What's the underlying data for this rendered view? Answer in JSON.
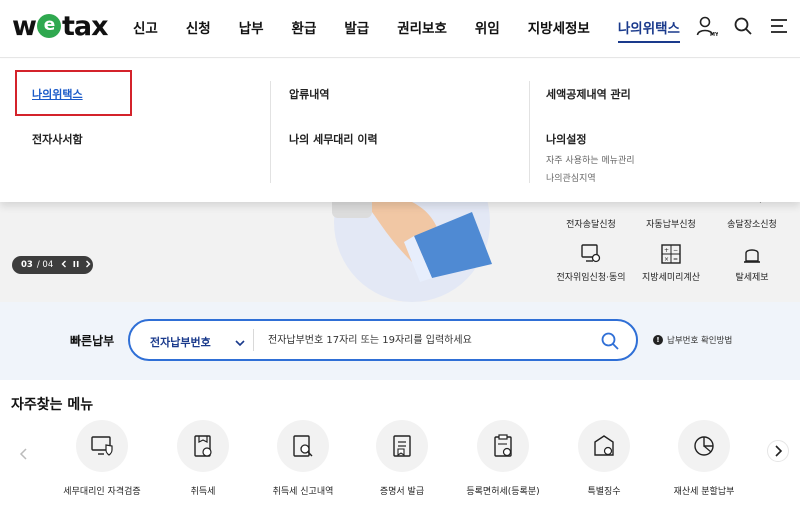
{
  "header": {
    "logo": {
      "pre": "w",
      "mid": "e",
      "post": "tax"
    },
    "nav": [
      "신고",
      "신청",
      "납부",
      "환급",
      "발급",
      "권리보호",
      "위임",
      "지방세정보",
      "나의위택스"
    ],
    "icons": [
      "user-my-icon",
      "search-icon",
      "menu-icon"
    ],
    "my_badge": "MY"
  },
  "mega_menu": {
    "col1": [
      "나의위택스",
      "전자사서함"
    ],
    "col2": [
      "압류내역",
      "나의 세무대리 이력"
    ],
    "col3": {
      "item1": "세액공제내역 관리",
      "item2": "나의설정",
      "subs": [
        "자주 사용하는 메뉴관리",
        "나의관심지역"
      ]
    }
  },
  "hero": {
    "pager": {
      "current": "03",
      "total": "/ 04"
    },
    "quick_icons": [
      {
        "label": "전자송달신청",
        "icon": "mail-icon"
      },
      {
        "label": "자동납부신청",
        "icon": "auto-pay-icon"
      },
      {
        "label": "송달장소신청",
        "icon": "location-icon"
      },
      {
        "label": "전자위임신청·동의",
        "icon": "delegate-icon"
      },
      {
        "label": "지방세미리계산",
        "icon": "calculator-icon"
      },
      {
        "label": "탈세제보",
        "icon": "siren-icon"
      }
    ]
  },
  "quick_pay": {
    "title": "빠른납부",
    "select": "전자납부번호",
    "placeholder": "전자납부번호 17자리 또는 19자리를 입력하세요",
    "help": "납부번호 확인방법",
    "help_mark": "!"
  },
  "favorites": {
    "title": "자주찾는 메뉴",
    "items": [
      {
        "label": "세무대리인 자격검증",
        "icon": "monitor-shield-icon"
      },
      {
        "label": "취득세",
        "icon": "tax-doc-icon"
      },
      {
        "label": "취득세 신고내역",
        "icon": "doc-search-icon"
      },
      {
        "label": "증명서 발급",
        "icon": "certificate-icon"
      },
      {
        "label": "등록면허세(등록분)",
        "icon": "clipboard-icon"
      },
      {
        "label": "특별징수",
        "icon": "mailbox-icon"
      },
      {
        "label": "재산세 분할납부",
        "icon": "pie-chart-icon"
      }
    ]
  },
  "colors": {
    "accent": "#2f6fd6",
    "nav_active": "#1a3a8c",
    "highlight": "#d4232b",
    "logo_green": "#2fa84f"
  }
}
